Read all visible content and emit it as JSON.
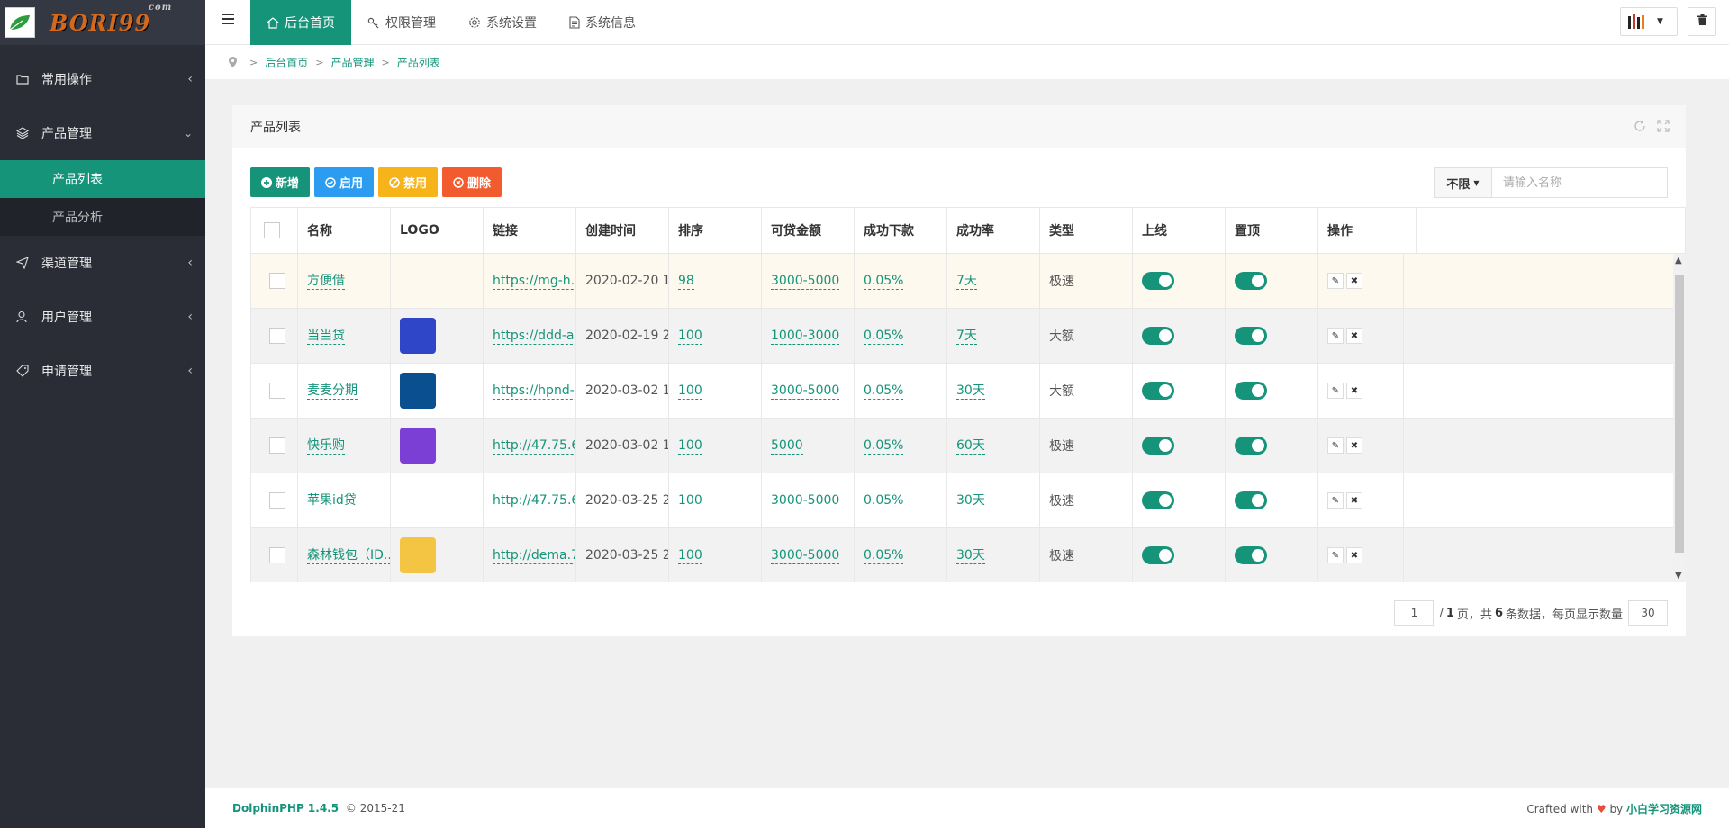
{
  "logo": {
    "text": "BORI99",
    "suffix": "com"
  },
  "sidebar": {
    "items": [
      {
        "label": "常用操作"
      },
      {
        "label": "产品管理"
      },
      {
        "label": "渠道管理"
      },
      {
        "label": "用户管理"
      },
      {
        "label": "申请管理"
      }
    ],
    "sub_items": [
      {
        "label": "产品列表"
      },
      {
        "label": "产品分析"
      }
    ]
  },
  "topbar": {
    "tabs": [
      {
        "label": "后台首页"
      },
      {
        "label": "权限管理"
      },
      {
        "label": "系统设置"
      },
      {
        "label": "系统信息"
      }
    ]
  },
  "breadcrumb": {
    "items": [
      "后台首页",
      "产品管理",
      "产品列表"
    ]
  },
  "panel": {
    "title": "产品列表"
  },
  "toolbar": {
    "add_label": "新增",
    "enable_label": "启用",
    "disable_label": "禁用",
    "delete_label": "删除"
  },
  "search": {
    "filter_label": "不限",
    "placeholder": "请输入名称"
  },
  "table": {
    "headers": [
      "名称",
      "LOGO",
      "链接",
      "创建时间",
      "排序",
      "可贷金额",
      "成功下款",
      "成功率",
      "类型",
      "上线",
      "置顶",
      "操作"
    ],
    "rows": [
      {
        "name": "方便借",
        "link": "https://mg-h...",
        "created": "2020-02-20 1...",
        "sort": "98",
        "amount": "3000-5000",
        "success": "0.05%",
        "rate": "7天",
        "type": "极速",
        "online": true,
        "top": true,
        "logo_color": "#fdf9ee"
      },
      {
        "name": "当当贷",
        "link": "https://ddd-a...",
        "created": "2020-02-19 2...",
        "sort": "100",
        "amount": "1000-3000",
        "success": "0.05%",
        "rate": "7天",
        "type": "大额",
        "online": true,
        "top": true,
        "logo_color": "#2f46c8"
      },
      {
        "name": "麦麦分期",
        "link": "https://hpnd-...",
        "created": "2020-03-02 1...",
        "sort": "100",
        "amount": "3000-5000",
        "success": "0.05%",
        "rate": "30天",
        "type": "大额",
        "online": true,
        "top": true,
        "logo_color": "#0a4f8f"
      },
      {
        "name": "快乐购",
        "link": "http://47.75.6...",
        "created": "2020-03-02 1...",
        "sort": "100",
        "amount": "5000",
        "success": "0.05%",
        "rate": "60天",
        "type": "极速",
        "online": true,
        "top": true,
        "logo_color": "#7b3fd6"
      },
      {
        "name": "苹果id贷",
        "link": "http://47.75.6...",
        "created": "2020-03-25 2...",
        "sort": "100",
        "amount": "3000-5000",
        "success": "0.05%",
        "rate": "30天",
        "type": "极速",
        "online": true,
        "top": true,
        "logo_color": "#ffffff"
      },
      {
        "name": "森林钱包（ID...",
        "link": "http://dema.7...",
        "created": "2020-03-25 2...",
        "sort": "100",
        "amount": "3000-5000",
        "success": "0.05%",
        "rate": "30天",
        "type": "极速",
        "online": true,
        "top": true,
        "logo_color": "#f4c542"
      }
    ]
  },
  "pager": {
    "current": "1",
    "text_total_prefix": "/",
    "total_pages": "1",
    "text_mid": "页，共",
    "total_rows": "6",
    "text_suffix": "条数据，每页显示数量",
    "per_page": "30"
  },
  "footer": {
    "brand": "DolphinPHP 1.4.5",
    "copy": "© 2015-21",
    "crafted": "Crafted with",
    "by": "by",
    "author": "小白学习资源网"
  },
  "colors": {
    "accent": "#15947a",
    "sidebar_bg": "#2a2d36",
    "blue": "#2b9cf0",
    "yellow": "#f7b41a",
    "red": "#f25b2e"
  }
}
